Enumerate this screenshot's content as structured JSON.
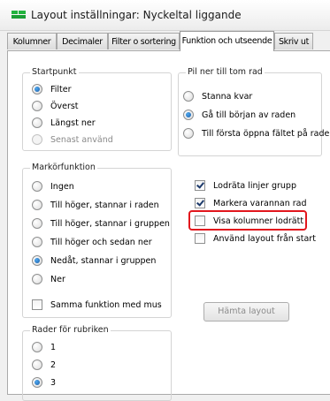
{
  "window": {
    "title": "Layout inställningar: Nyckeltal liggande",
    "icon": "app-icon"
  },
  "tabs": [
    {
      "label": "Kolumner"
    },
    {
      "label": "Decimaler"
    },
    {
      "label": "Filter o sortering"
    },
    {
      "label": "Funktion och utseende",
      "active": true
    },
    {
      "label": "Skriv ut"
    }
  ],
  "startpunkt": {
    "title": "Startpunkt",
    "options": [
      {
        "label": "Filter",
        "checked": true
      },
      {
        "label": "Överst"
      },
      {
        "label": "Längst ner"
      },
      {
        "label": "Senast använd",
        "disabled": true
      }
    ]
  },
  "pil_ner": {
    "title": "Pil ner till tom rad",
    "options": [
      {
        "label": "Stanna kvar"
      },
      {
        "label": "Gå till början av raden",
        "checked": true
      },
      {
        "label": "Till första öppna fältet på raden"
      }
    ]
  },
  "markorfunktion": {
    "title": "Markörfunktion",
    "options": [
      {
        "label": "Ingen"
      },
      {
        "label": "Till höger, stannar i raden"
      },
      {
        "label": "Till höger, stannar i gruppen"
      },
      {
        "label": "Till höger och sedan ner"
      },
      {
        "label": "Nedåt, stannar i gruppen",
        "checked": true
      },
      {
        "label": "Ner"
      }
    ],
    "checkbox": {
      "label": "Samma funktion med mus",
      "checked": false
    }
  },
  "checkboxes": [
    {
      "label": "Lodräta linjer grupp",
      "checked": true
    },
    {
      "label": "Markera varannan rad",
      "checked": true
    },
    {
      "label": "Visa kolumner lodrätt",
      "checked": false,
      "highlighted": true
    },
    {
      "label": "Använd layout från start",
      "checked": false
    }
  ],
  "hamta_button": {
    "label": "Hämta layout",
    "enabled": false
  },
  "rader_rubriken": {
    "title": "Rader för rubriken",
    "options": [
      {
        "label": "1"
      },
      {
        "label": "2"
      },
      {
        "label": "3",
        "checked": true
      }
    ]
  },
  "colors": {
    "highlight": "#e2161d",
    "radio_fill": "#1c5fa8",
    "tab_border": "#a8a8a8"
  }
}
